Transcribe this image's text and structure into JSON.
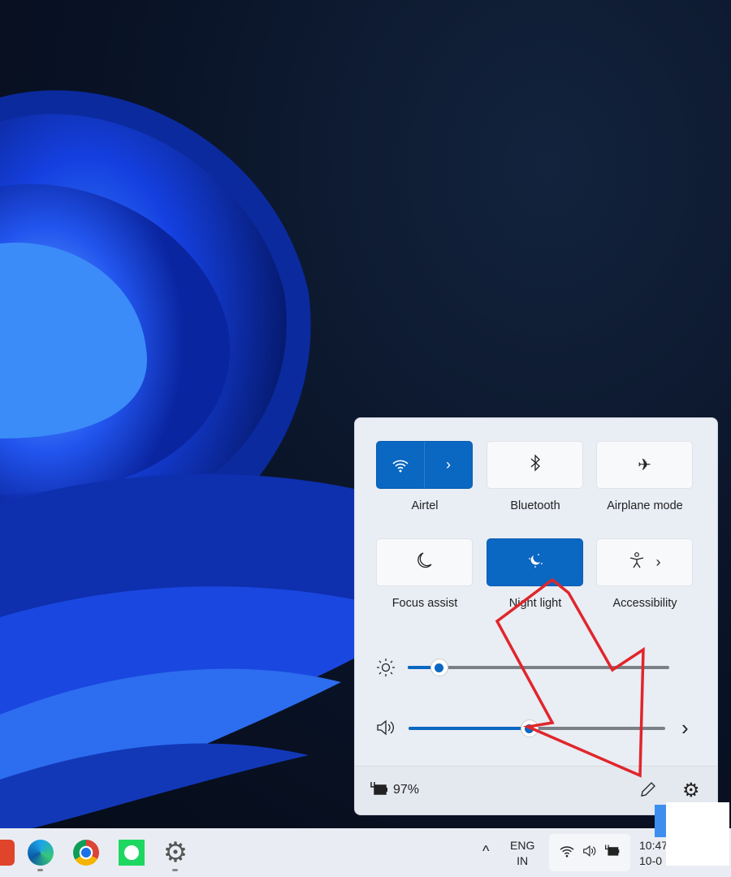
{
  "quick_settings": {
    "tiles": [
      {
        "label": "Airtel",
        "icon": "wifi-icon",
        "active": true,
        "expand": true
      },
      {
        "label": "Bluetooth",
        "icon": "bluetooth-icon",
        "active": false
      },
      {
        "label": "Airplane mode",
        "icon": "airplane-icon",
        "active": false
      },
      {
        "label": "Focus assist",
        "icon": "moon-icon",
        "active": false
      },
      {
        "label": "Night light",
        "icon": "night-light-icon",
        "active": true
      },
      {
        "label": "Accessibility",
        "icon": "accessibility-icon",
        "active": false,
        "expand": true
      }
    ],
    "brightness_percent": 12,
    "volume_percent": 47,
    "battery": "97%",
    "accent_color": "#0a67c2"
  },
  "taskbar": {
    "language": {
      "line1": "ENG",
      "line2": "IN"
    },
    "clock": {
      "time": "10:47",
      "date": "10-0"
    },
    "apps": [
      "brave-icon",
      "edge-icon",
      "chrome-icon",
      "spotify-icon",
      "settings-icon"
    ]
  },
  "annotation": {
    "color": "#e0262b"
  }
}
